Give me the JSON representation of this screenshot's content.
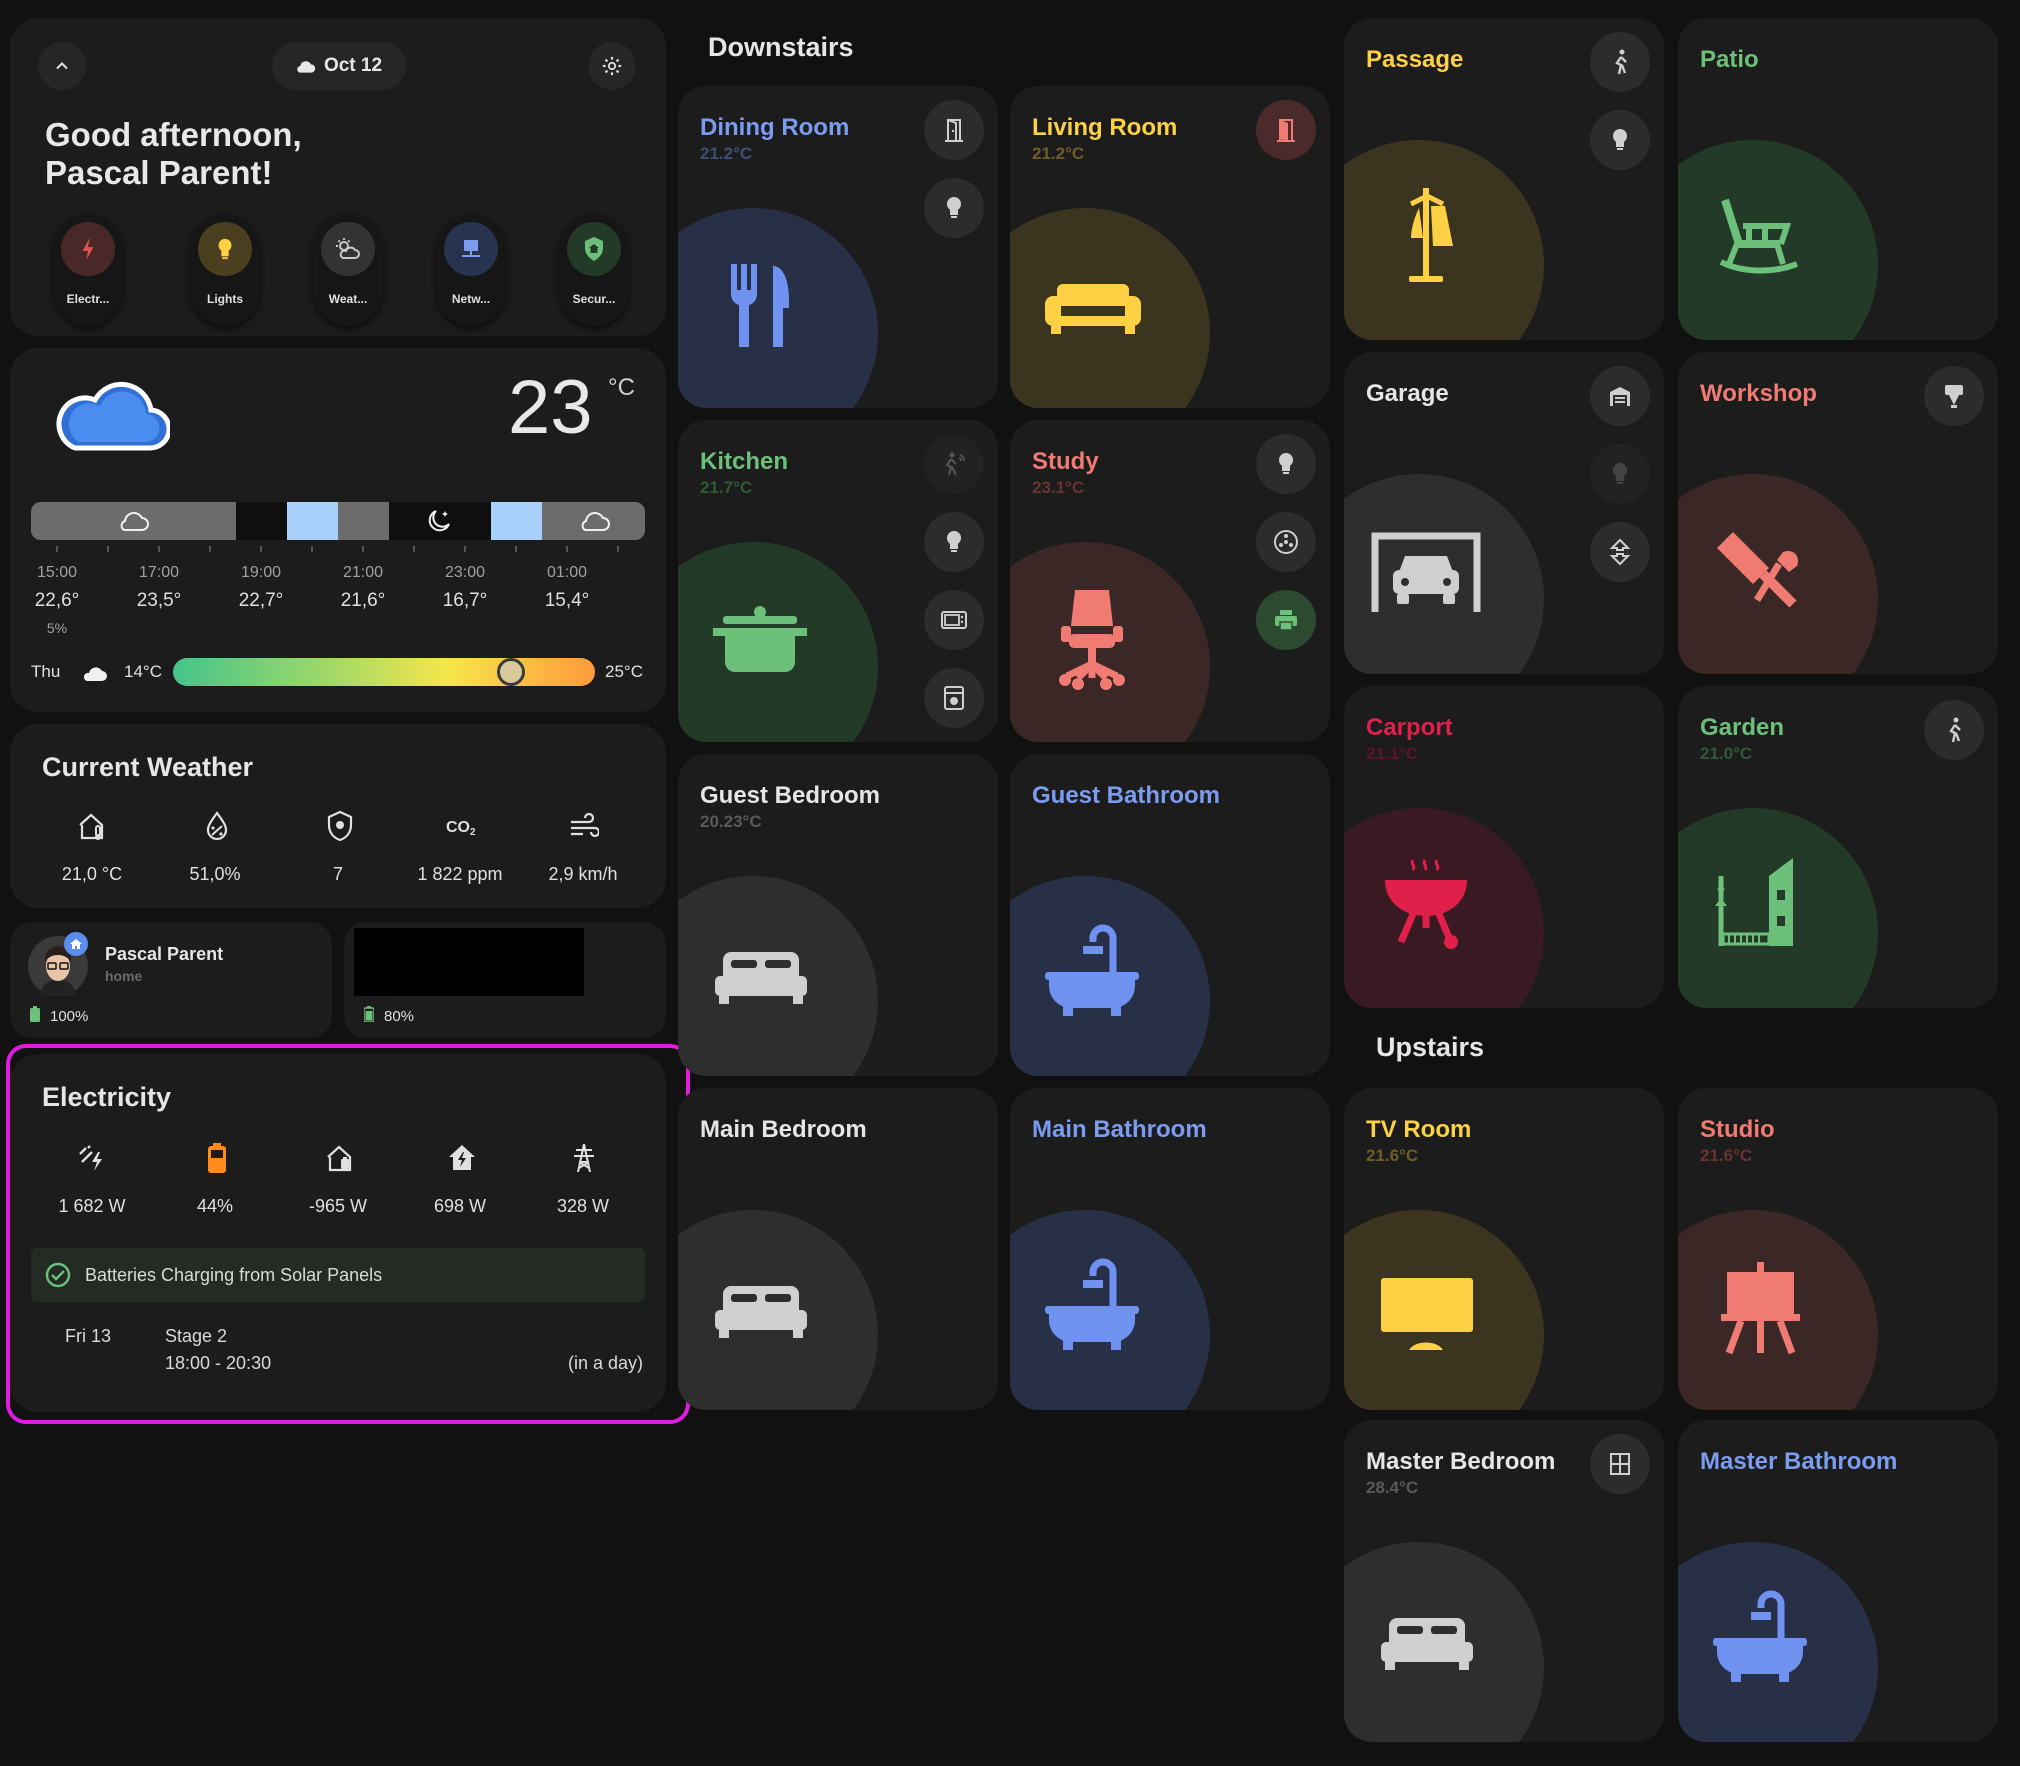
{
  "header": {
    "date": "Oct 12",
    "greeting_line1": "Good afternoon,",
    "greeting_line2": "Pascal Parent!",
    "chips": [
      {
        "label": "Electr...",
        "icon": "lightning-icon",
        "color": "#e0554f"
      },
      {
        "label": "Lights",
        "icon": "lightbulb-icon",
        "color": "#fdd143"
      },
      {
        "label": "Weat...",
        "icon": "weather-partly-icon",
        "color": "#b8b8b8"
      },
      {
        "label": "Netw...",
        "icon": "network-icon",
        "color": "#7d9cf0"
      },
      {
        "label": "Secur...",
        "icon": "shield-home-icon",
        "color": "#6cc07a"
      }
    ]
  },
  "weather": {
    "current_temp": "23",
    "unit": "°C",
    "forecast": [
      {
        "time": "15:00",
        "temp": "22,6°",
        "precip": "5%"
      },
      {
        "time": "17:00",
        "temp": "23,5°",
        "precip": ""
      },
      {
        "time": "19:00",
        "temp": "22,7°",
        "precip": ""
      },
      {
        "time": "21:00",
        "temp": "21,6°",
        "precip": ""
      },
      {
        "time": "23:00",
        "temp": "16,7°",
        "precip": ""
      },
      {
        "time": "01:00",
        "temp": "15,4°",
        "precip": ""
      }
    ],
    "daily": {
      "day": "Thu",
      "low": "14°C",
      "high": "25°C",
      "current_position": 0.8
    }
  },
  "current_weather": {
    "title": "Current Weather",
    "items": [
      {
        "icon": "home-thermometer-icon",
        "value": "21,0 °C"
      },
      {
        "icon": "water-percent-icon",
        "value": "51,0%"
      },
      {
        "icon": "shield-sun-icon",
        "value": "7"
      },
      {
        "icon": "co2-icon",
        "value": "1 822 ppm"
      },
      {
        "icon": "wind-icon",
        "value": "2,9 km/h"
      }
    ]
  },
  "persons": [
    {
      "name": "Pascal Parent",
      "state": "home",
      "battery": "100%"
    },
    {
      "name": "",
      "state": "",
      "battery": "80%"
    }
  ],
  "electricity": {
    "title": "Electricity",
    "items": [
      {
        "icon": "solar-power-icon",
        "value": "1 682 W"
      },
      {
        "icon": "battery-icon",
        "value": "44%"
      },
      {
        "icon": "home-export-icon",
        "value": "-965 W"
      },
      {
        "icon": "home-lightning-icon",
        "value": "698 W"
      },
      {
        "icon": "transmission-tower-icon",
        "value": "328 W"
      }
    ],
    "status": "Batteries Charging from Solar Panels",
    "schedule": {
      "day": "Fri 13",
      "stage": "Stage 2",
      "time": "18:00 - 20:30",
      "relative": "(in a day)"
    }
  },
  "areas": {
    "downstairs": "Downstairs",
    "upstairs": "Upstairs"
  },
  "rooms": {
    "dining_room": {
      "name": "Dining Room",
      "temp": "21.2°C",
      "color": "#7b9cf0"
    },
    "living_room": {
      "name": "Living Room",
      "temp": "21.2°C",
      "color": "#fdd143"
    },
    "kitchen": {
      "name": "Kitchen",
      "temp": "21.7°C",
      "color": "#6cc07a"
    },
    "study": {
      "name": "Study",
      "temp": "23.1°C",
      "color": "#ef7b73"
    },
    "guest_bedroom": {
      "name": "Guest Bedroom",
      "temp": "20.23°C",
      "color": "#e6e6e6"
    },
    "guest_bathroom": {
      "name": "Guest Bathroom",
      "temp": "",
      "color": "#7b9cf0"
    },
    "main_bedroom": {
      "name": "Main Bedroom",
      "temp": "",
      "color": "#e6e6e6"
    },
    "main_bathroom": {
      "name": "Main Bathroom",
      "temp": "",
      "color": "#7b9cf0"
    },
    "passage": {
      "name": "Passage",
      "temp": "",
      "color": "#fdd143"
    },
    "patio": {
      "name": "Patio",
      "temp": "",
      "color": "#6cc07a"
    },
    "garage": {
      "name": "Garage",
      "temp": "",
      "color": "#e6e6e6"
    },
    "workshop": {
      "name": "Workshop",
      "temp": "",
      "color": "#ef7b73"
    },
    "carport": {
      "name": "Carport",
      "temp": "21.1°C",
      "color": "#e0204a"
    },
    "garden": {
      "name": "Garden",
      "temp": "21.0°C",
      "color": "#6cc07a"
    },
    "tv_room": {
      "name": "TV Room",
      "temp": "21.6°C",
      "color": "#fdd143"
    },
    "studio": {
      "name": "Studio",
      "temp": "21.6°C",
      "color": "#ef7b73"
    },
    "master_bedroom": {
      "name": "Master Bedroom",
      "temp": "28.4°C",
      "color": "#e6e6e6"
    },
    "master_bathroom": {
      "name": "Master Bathroom",
      "temp": "",
      "color": "#7b9cf0"
    }
  }
}
